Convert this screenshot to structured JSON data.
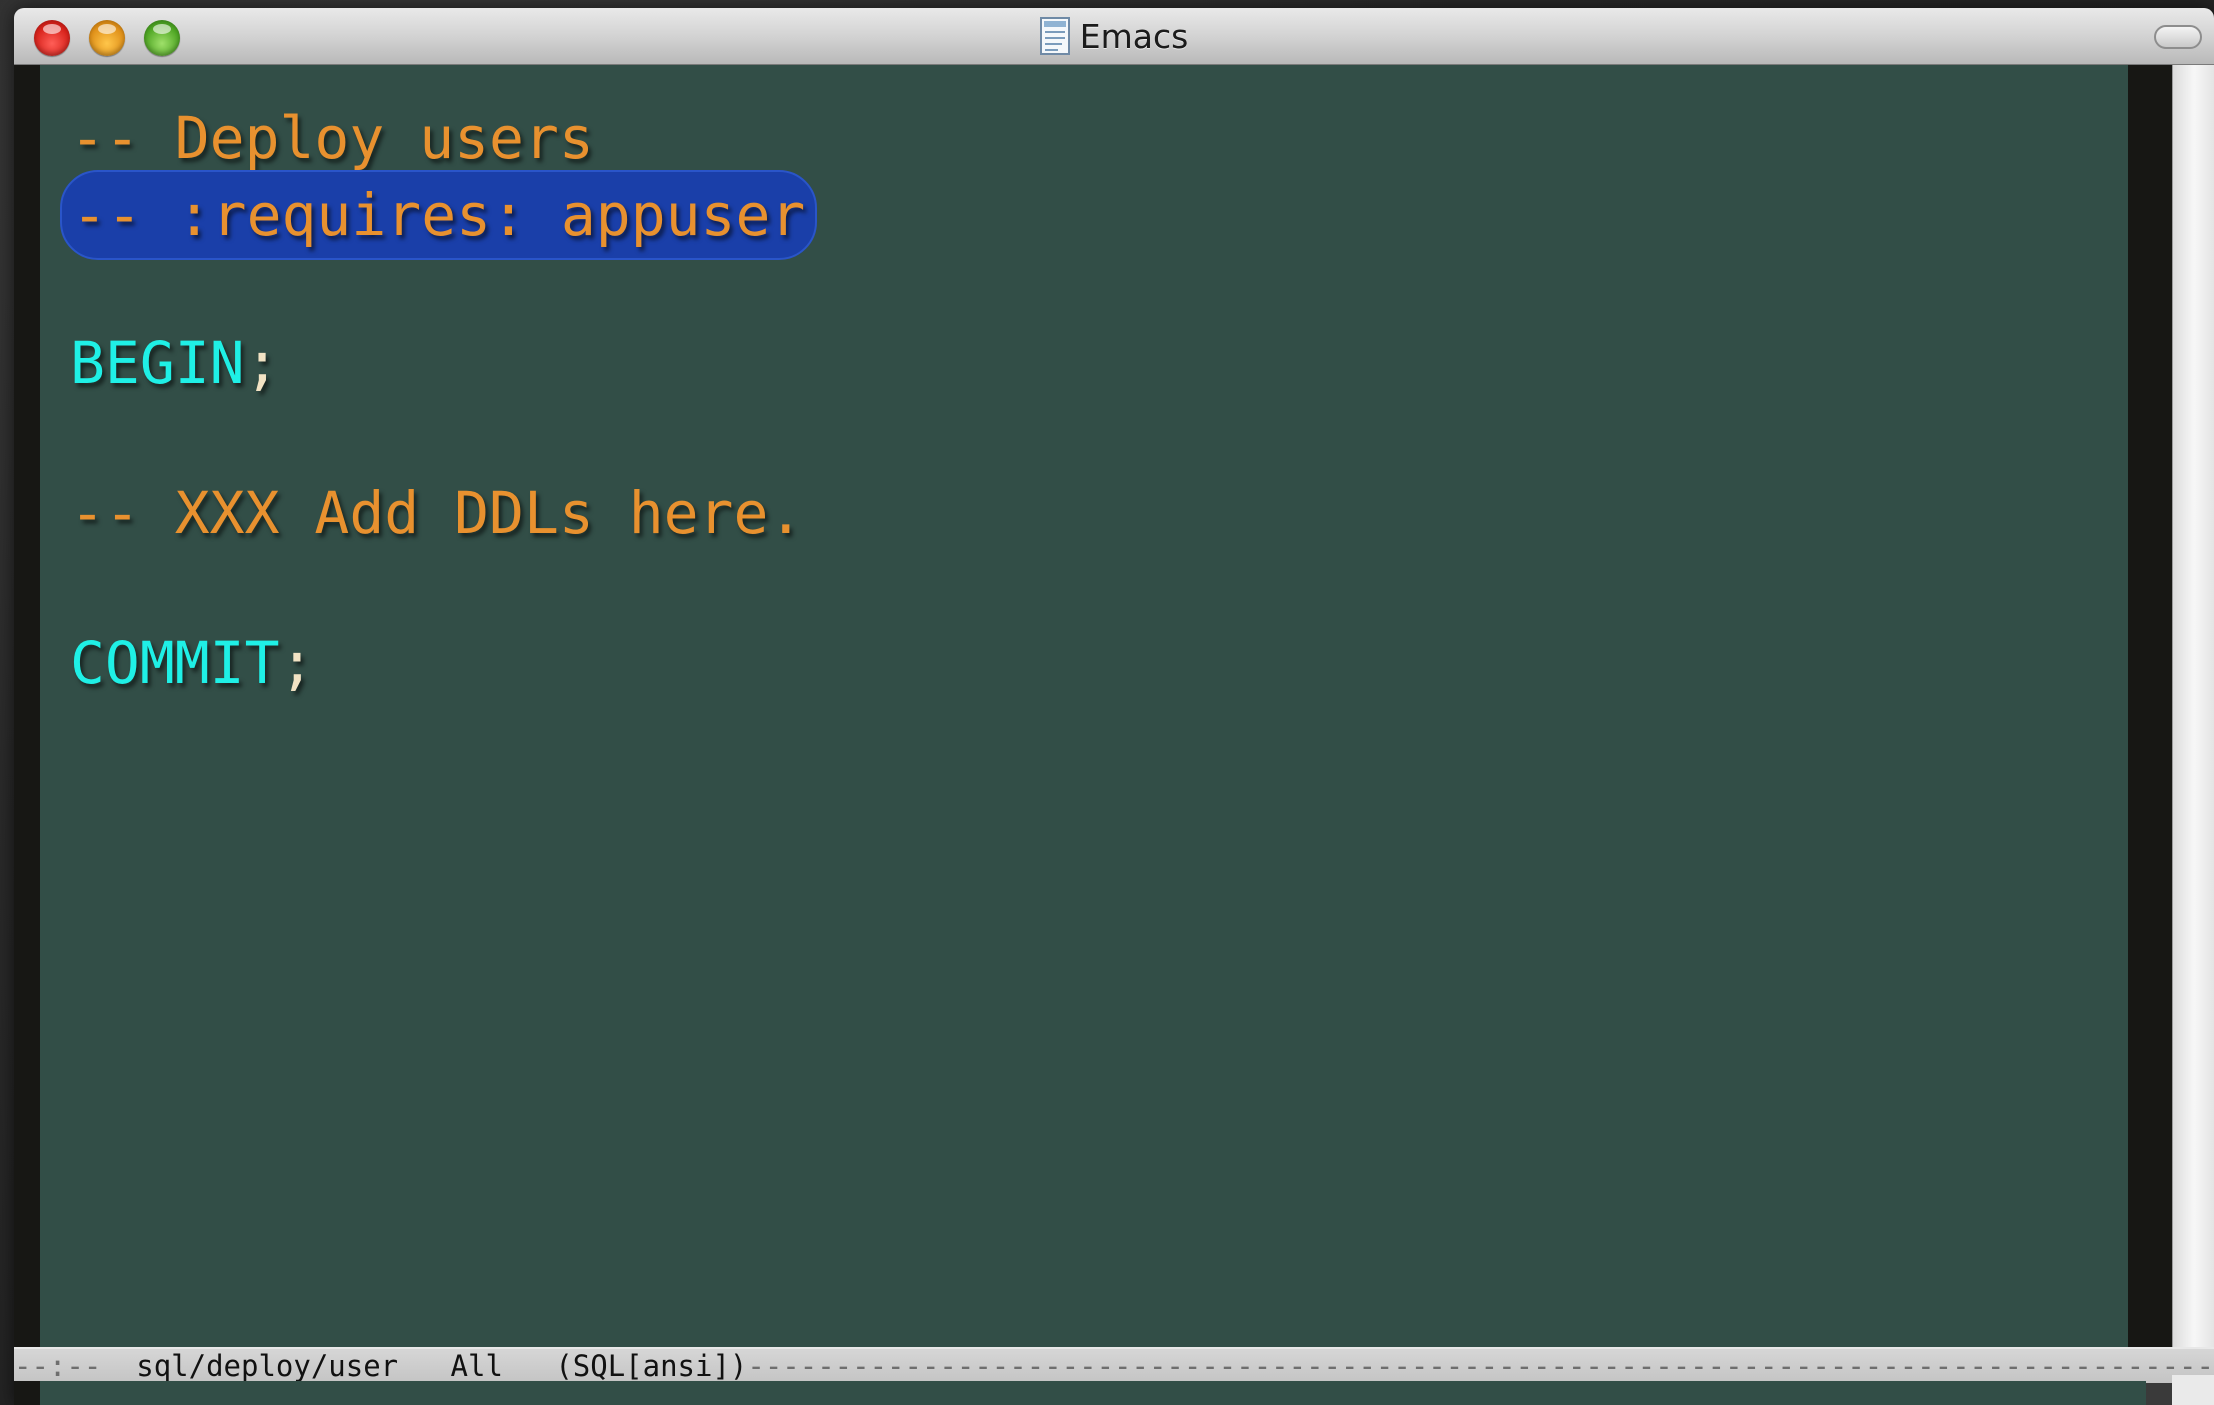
{
  "window": {
    "title": "Emacs"
  },
  "editor": {
    "lines": [
      [
        {
          "text": "-- Deploy users",
          "kind": "comment"
        }
      ],
      [
        {
          "text": "-- :requires: appuser",
          "kind": "comment",
          "highlighted": true
        }
      ],
      [],
      [
        {
          "text": "BEGIN",
          "kind": "keyword"
        },
        {
          "text": ";",
          "kind": "punct"
        }
      ],
      [],
      [
        {
          "text": "-- XXX Add DDLs here.",
          "kind": "comment"
        }
      ],
      [],
      [
        {
          "text": "COMMIT",
          "kind": "keyword"
        },
        {
          "text": ";",
          "kind": "punct"
        }
      ]
    ]
  },
  "modeline": {
    "status": "--:--",
    "buffer": "sql/deploy/user",
    "position": "All",
    "mode": "(SQL[ansi])"
  },
  "colors": {
    "background": "#324e47",
    "comment": "#e8912f",
    "keyword": "#1ff0e6",
    "highlight": "#1a3fa9"
  },
  "icons": {
    "close": "close-button-icon",
    "minimize": "minimize-button-icon",
    "zoom": "zoom-button-icon",
    "document": "document-icon",
    "toolbar": "toolbar-toggle-icon"
  }
}
